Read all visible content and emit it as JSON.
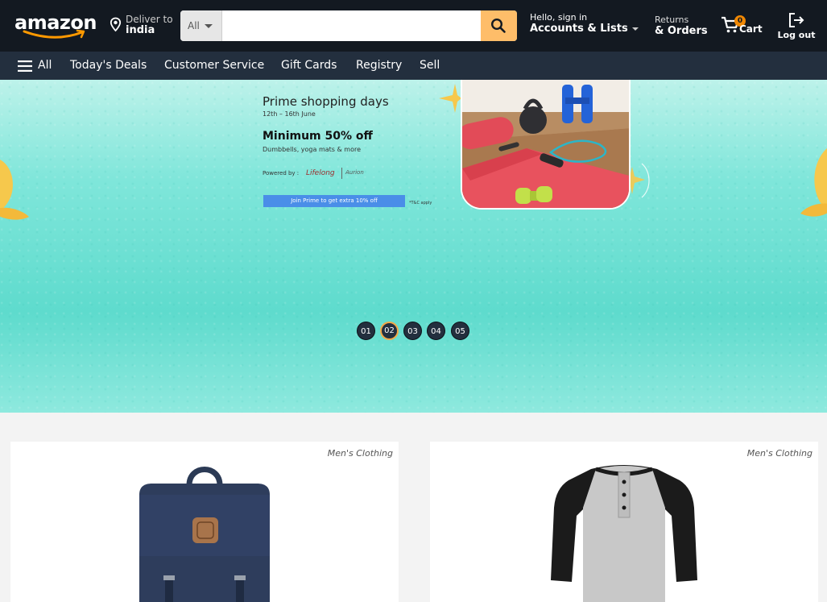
{
  "header": {
    "logo_text": "amazon",
    "deliver": {
      "line1": "Deliver to",
      "line2": "india"
    },
    "search": {
      "category": "All",
      "placeholder": ""
    },
    "account": {
      "line1": "Hello, sign in",
      "line2": "Accounts & Lists"
    },
    "returns": {
      "line1": "Returns",
      "line2": "& Orders"
    },
    "cart": {
      "count": "0",
      "label": "Cart"
    },
    "logout": {
      "label": "Log out"
    }
  },
  "subnav": {
    "all_label": "All",
    "items": [
      "Today's Deals",
      "Customer Service",
      "Gift Cards",
      "Registry",
      "Sell"
    ]
  },
  "hero": {
    "title": "Prime shopping days",
    "dates": "12th – 16th June",
    "offer": "Minimum 50% off",
    "items": "Dumbbells, yoga mats & more",
    "powered_by": "Powered by :",
    "brand1": "Lifelong",
    "brand2": "Aurion",
    "cta": "Join Prime to get extra 10% off",
    "tc": "*T&C apply",
    "pager": [
      "01",
      "02",
      "03",
      "04",
      "05"
    ],
    "active_page": "02"
  },
  "products": [
    {
      "category": "Men's Clothing",
      "name": "backpack"
    },
    {
      "category": "Men's Clothing",
      "name": "henley-tshirt"
    }
  ],
  "colors": {
    "nav_top": "#131921",
    "nav_sub": "#232f3e",
    "search_button": "#febd69",
    "accent": "#f08804",
    "hero": "#5edbcd"
  }
}
